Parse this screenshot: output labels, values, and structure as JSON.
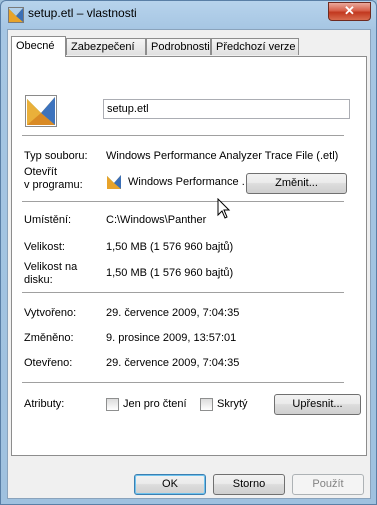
{
  "window": {
    "title": "setup.etl – vlastnosti",
    "close_glyph": "✕"
  },
  "tabs": [
    {
      "label": "Obecné",
      "active": true
    },
    {
      "label": "Zabezpečení",
      "active": false
    },
    {
      "label": "Podrobnosti",
      "active": false
    },
    {
      "label": "Předchozí verze",
      "active": false
    }
  ],
  "general": {
    "filename": "setup.etl",
    "file_type_label": "Typ souboru:",
    "file_type_value": "Windows Performance Analyzer Trace File (.etl)",
    "opens_with_label_line1": "Otevřít",
    "opens_with_label_line2": "v programu:",
    "opens_with_value": "Windows Performance .",
    "change_button": "Změnit...",
    "location_label": "Umístění:",
    "location_value": "C:\\Windows\\Panther",
    "size_label": "Velikost:",
    "size_value": "1,50 MB (1 576 960 bajtů)",
    "size_on_disk_label_line1": "Velikost na",
    "size_on_disk_label_line2": "disku:",
    "size_on_disk_value": "1,50 MB (1 576 960 bajtů)",
    "created_label": "Vytvořeno:",
    "created_value": "29. července 2009, 7:04:35",
    "modified_label": "Změněno:",
    "modified_value": "9. prosince 2009, 13:57:01",
    "accessed_label": "Otevřeno:",
    "accessed_value": "29. července 2009, 7:04:35",
    "attributes_label": "Atributy:",
    "readonly_label": "Jen pro čtení",
    "readonly_checked": false,
    "hidden_label": "Skrytý",
    "hidden_checked": false,
    "advanced_button": "Upřesnit..."
  },
  "footer": {
    "ok": "OK",
    "cancel": "Storno",
    "apply": "Použít"
  },
  "icons": {
    "file_icon": "etl-file-icon",
    "app_icon": "windows-performance-analyzer-icon"
  }
}
